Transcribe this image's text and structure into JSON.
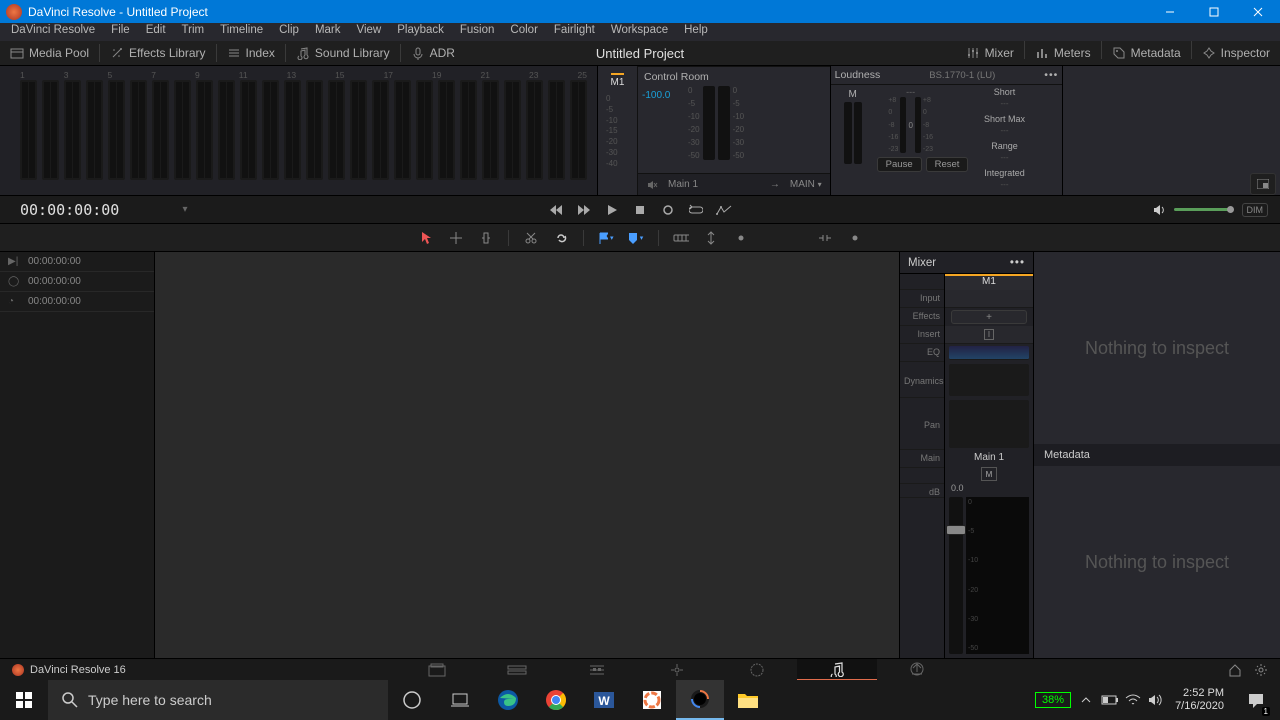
{
  "window": {
    "title": "DaVinci Resolve - Untitled Project"
  },
  "menubar": {
    "items": [
      "DaVinci Resolve",
      "File",
      "Edit",
      "Trim",
      "Timeline",
      "Clip",
      "Mark",
      "View",
      "Playback",
      "Fusion",
      "Color",
      "Fairlight",
      "Workspace",
      "Help"
    ]
  },
  "toolbar": {
    "media_pool": "Media Pool",
    "effects_library": "Effects Library",
    "index": "Index",
    "sound_library": "Sound Library",
    "adr": "ADR",
    "project_title": "Untitled Project",
    "mixer": "Mixer",
    "meters": "Meters",
    "metadata": "Metadata",
    "inspector": "Inspector"
  },
  "meters": {
    "m1_label": "M1",
    "control_room": {
      "label": "Control Room",
      "db": "-100.0",
      "monitor": "Main 1",
      "out_select": "MAIN"
    },
    "loudness": {
      "label": "Loudness",
      "standard": "BS.1770-1 (LU)",
      "m_label": "M",
      "short": "Short",
      "short_max": "Short Max",
      "range": "Range",
      "integrated": "Integrated",
      "pause": "Pause",
      "reset": "Reset",
      "dash": "---",
      "zero": "0"
    },
    "db_marks": [
      "+8",
      "0",
      "-8",
      "-16",
      "-23"
    ]
  },
  "transport": {
    "timecode": "00:00:00:00",
    "dim": "DIM"
  },
  "left_timecodes": {
    "tc": "00:00:00:00"
  },
  "mixer": {
    "title": "Mixer",
    "labels": {
      "input": "Input",
      "effects": "Effects",
      "insert": "Insert",
      "eq": "EQ",
      "dynamics": "Dynamics",
      "pan": "Pan",
      "main": "Main",
      "db": "dB"
    },
    "strip": {
      "name": "M1",
      "main": "Main 1",
      "mute": "M",
      "db": "0.0"
    },
    "fader_marks": [
      "0",
      "-5",
      "-10",
      "-20",
      "-30",
      "-50"
    ]
  },
  "inspector": {
    "nothing": "Nothing to inspect",
    "metadata_label": "Metadata"
  },
  "footer": {
    "app": "DaVinci Resolve 16"
  },
  "taskbar": {
    "search_placeholder": "Type here to search",
    "battery": "38%",
    "time": "2:52 PM",
    "date": "7/16/2020",
    "notif_count": "1"
  }
}
